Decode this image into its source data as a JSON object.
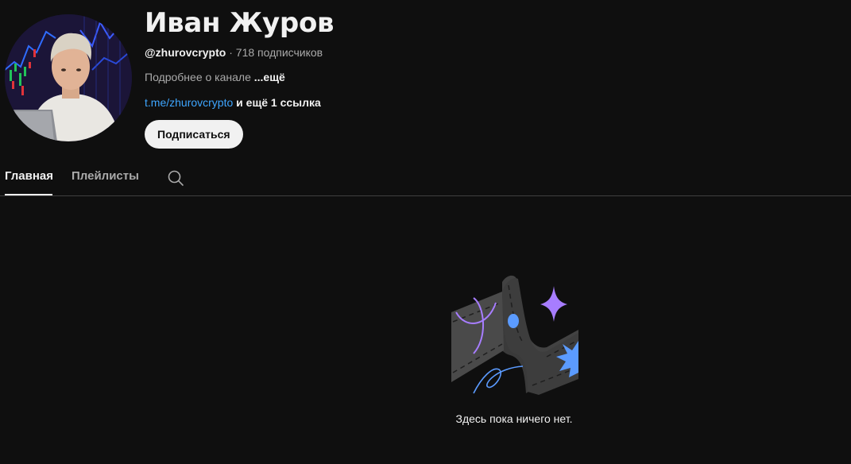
{
  "channel": {
    "name": "Иван Журов",
    "handle": "@zhurovcrypto",
    "separator": " · ",
    "subscribers": "718 подписчиков",
    "description": "Подробнее о канале",
    "description_more": "...ещё",
    "link": "t.me/zhurovcrypto",
    "link_more": "и ещё 1 ссылка",
    "subscribe_label": "Подписаться"
  },
  "tabs": [
    {
      "label": "Главная",
      "active": true
    },
    {
      "label": "Плейлисты",
      "active": false
    }
  ],
  "icons": {
    "search": "search-icon"
  },
  "empty_state": {
    "message": "Здесь пока ничего нет."
  },
  "colors": {
    "background": "#0f0f0f",
    "text": "#f1f1f1",
    "secondary_text": "#aaaaaa",
    "link": "#3ea6ff",
    "divider": "#3f3f3f",
    "button_bg": "#f1f1f1",
    "button_text": "#0f0f0f",
    "accent_purple": "#a77dff",
    "accent_blue": "#5b9bff"
  }
}
